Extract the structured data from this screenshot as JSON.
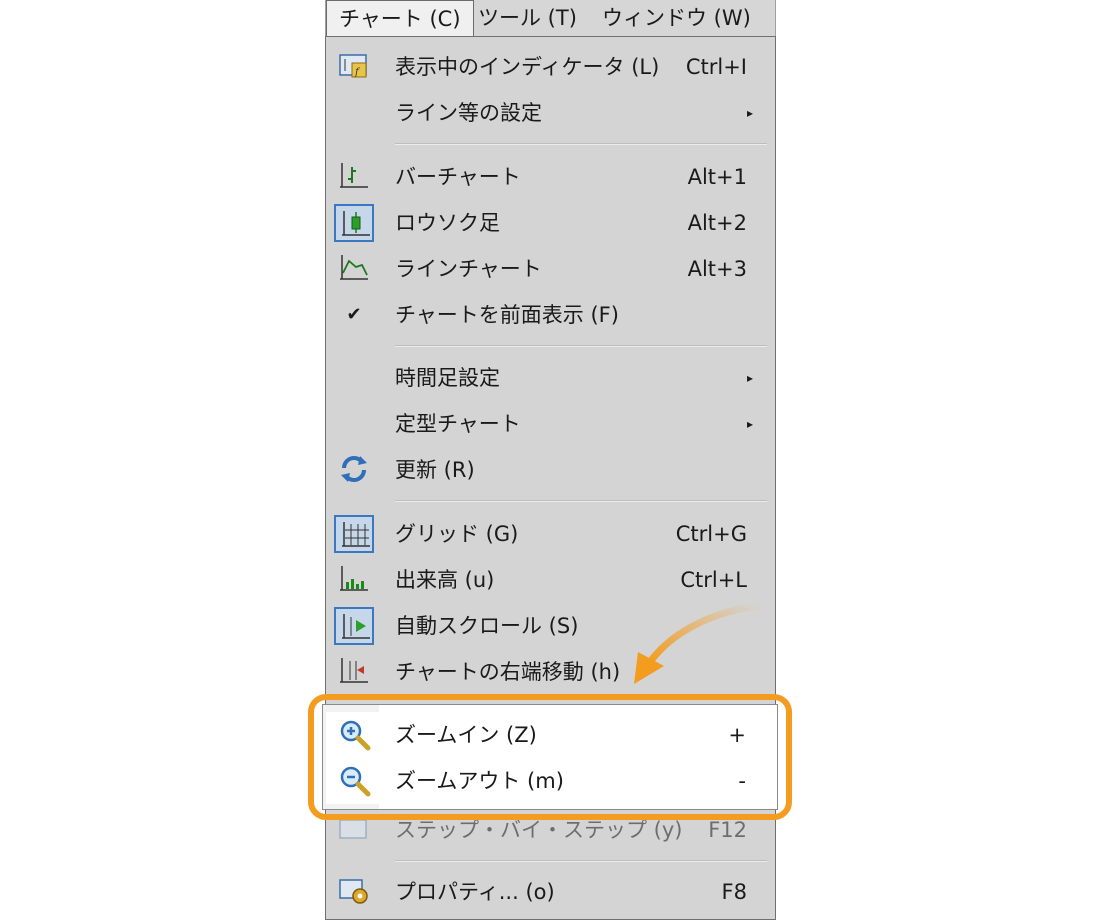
{
  "menubar": {
    "items": [
      {
        "label": "チャート (C)"
      },
      {
        "label": "ツール (T)"
      },
      {
        "label": "ウィンドウ (W)"
      }
    ]
  },
  "menu": {
    "items": [
      {
        "label": "表示中のインディケータ (L)",
        "shortcut": "Ctrl+I",
        "icon": "indicator-list-icon"
      },
      {
        "label": "ライン等の設定",
        "submenu": "▸"
      },
      {
        "label": "バーチャート",
        "shortcut": "Alt+1",
        "icon": "bar-chart-icon"
      },
      {
        "label": "ロウソク足",
        "shortcut": "Alt+2",
        "icon": "candlestick-icon"
      },
      {
        "label": "ラインチャート",
        "shortcut": "Alt+3",
        "icon": "line-chart-icon"
      },
      {
        "label": "チャートを前面表示 (F)",
        "icon": "checkmark-icon",
        "check": "✔"
      },
      {
        "label": "時間足設定",
        "submenu": "▸"
      },
      {
        "label": "定型チャート",
        "submenu": "▸"
      },
      {
        "label": "更新 (R)",
        "icon": "refresh-icon"
      },
      {
        "label": "グリッド (G)",
        "shortcut": "Ctrl+G",
        "icon": "grid-icon"
      },
      {
        "label": "出来高 (u)",
        "shortcut": "Ctrl+L",
        "icon": "volume-icon"
      },
      {
        "label": "自動スクロール (S)",
        "icon": "auto-scroll-icon"
      },
      {
        "label": "チャートの右端移動 (h)",
        "icon": "chart-shift-icon"
      },
      {
        "label": "ズームイン (Z)",
        "shortcut": "+",
        "icon": "zoom-in-icon"
      },
      {
        "label": "ズームアウト (m)",
        "shortcut": "-",
        "icon": "zoom-out-icon"
      },
      {
        "label": "ステップ・バイ・ステップ (y)",
        "shortcut": "F12",
        "icon": "step-by-step-icon"
      },
      {
        "label": "プロパティ... (o)",
        "shortcut": "F8",
        "icon": "properties-icon"
      }
    ]
  },
  "colors": {
    "highlight": "#f39c1f",
    "menu_bg": "#d4d4d4",
    "icon_accent": "#3a78c2"
  }
}
